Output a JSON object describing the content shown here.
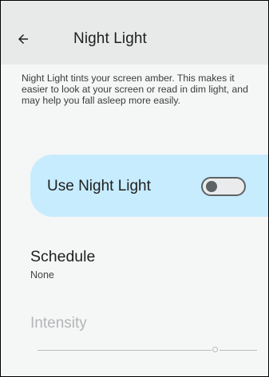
{
  "header": {
    "back_icon": "arrow-left-icon",
    "title": "Night Light"
  },
  "description": "Night Light tints your screen amber. This makes it easier to look at your screen or read in dim light, and may help you fall asleep more easily.",
  "night_light_toggle": {
    "label": "Use Night Light",
    "enabled": false,
    "card_color": "#c7ecfd"
  },
  "schedule": {
    "title": "Schedule",
    "value": "None"
  },
  "intensity": {
    "title": "Intensity",
    "value": 0.8,
    "disabled": true
  },
  "colors": {
    "background": "#f5f6f6",
    "app_bar": "#e8eaea",
    "text_primary": "#1f1f1f",
    "disabled_text": "#b3b6b7"
  }
}
